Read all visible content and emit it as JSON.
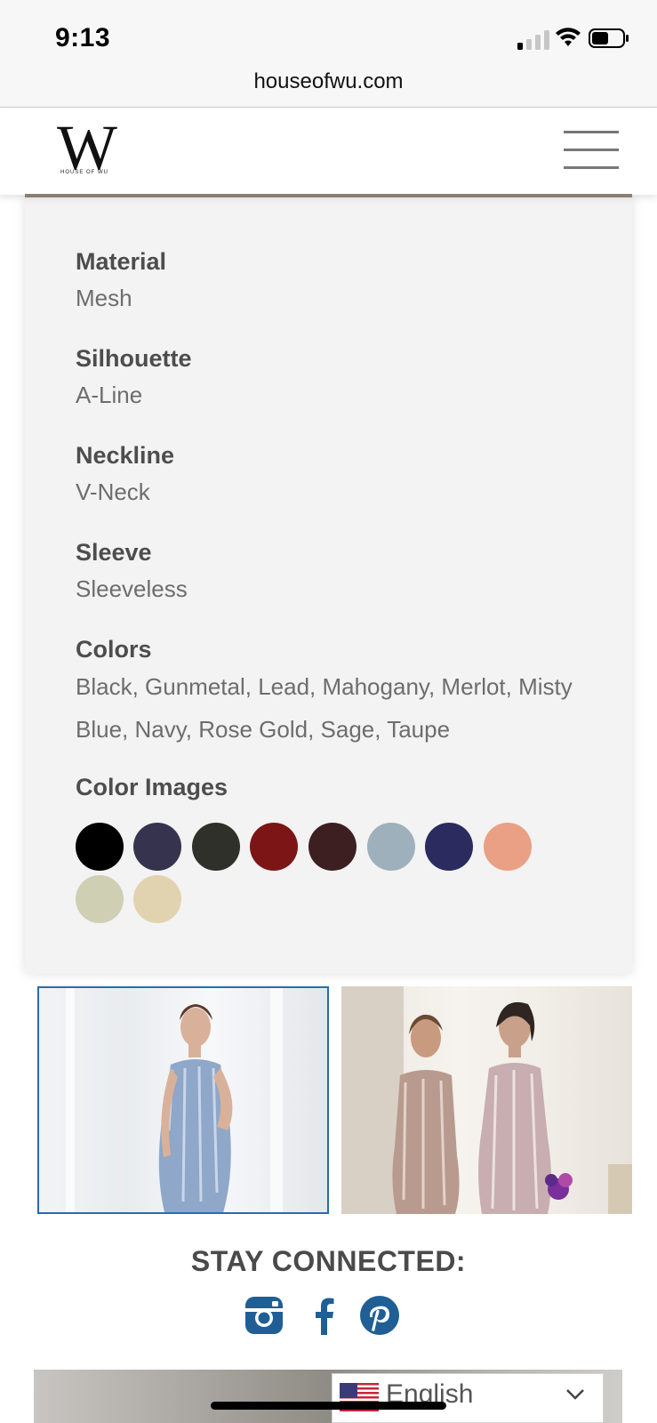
{
  "status": {
    "time": "9:13"
  },
  "browser": {
    "url": "houseofwu.com"
  },
  "header": {
    "logo_letter": "W",
    "logo_sub": "HOUSE OF WU"
  },
  "specs": [
    {
      "label": "Material",
      "value": "Mesh"
    },
    {
      "label": "Silhouette",
      "value": "A-Line"
    },
    {
      "label": "Neckline",
      "value": "V-Neck"
    },
    {
      "label": "Sleeve",
      "value": "Sleeveless"
    },
    {
      "label": "Colors",
      "value": "Black, Gunmetal, Lead, Mahogany, Merlot, Misty Blue, Navy, Rose Gold, Sage, Taupe"
    }
  ],
  "color_images": {
    "label": "Color Images",
    "swatches": [
      "#000000",
      "#36334f",
      "#30302b",
      "#7c1616",
      "#3e1f21",
      "#9eb0bb",
      "#2b2b5f",
      "#eaa084",
      "#cfcfb4",
      "#e2d3b0"
    ]
  },
  "photos": [
    {
      "icon": "product-photo-blue-dress",
      "selected": true
    },
    {
      "icon": "product-photo-rose-gold-dresses",
      "selected": false
    }
  ],
  "social": {
    "title": "STAY CONNECTED:",
    "icons": [
      "instagram-icon",
      "facebook-icon",
      "pinterest-icon"
    ],
    "color": "#1f5f96"
  },
  "language": {
    "label": "English",
    "flag": "us-flag-icon"
  }
}
